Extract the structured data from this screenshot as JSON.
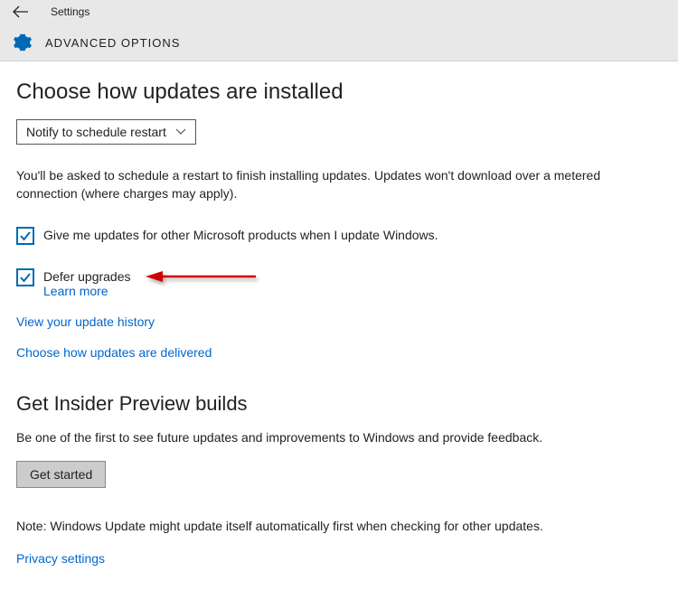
{
  "header": {
    "title": "Settings",
    "subtitle": "ADVANCED OPTIONS"
  },
  "section1": {
    "heading": "Choose how updates are installed",
    "dropdown": "Notify to schedule restart",
    "description": "You'll be asked to schedule a restart to finish installing updates. Updates won't download over a metered connection (where charges may apply)."
  },
  "checkbox1": {
    "label": "Give me updates for other Microsoft products when I update Windows."
  },
  "checkbox2": {
    "label": "Defer upgrades",
    "learn_more": "Learn more"
  },
  "links": {
    "history": "View your update history",
    "delivered": "Choose how updates are delivered",
    "privacy": "Privacy settings"
  },
  "section2": {
    "heading": "Get Insider Preview builds",
    "description": "Be one of the first to see future updates and improvements to Windows and provide feedback.",
    "button": "Get started"
  },
  "note": "Note: Windows Update might update itself automatically first when checking for other updates."
}
